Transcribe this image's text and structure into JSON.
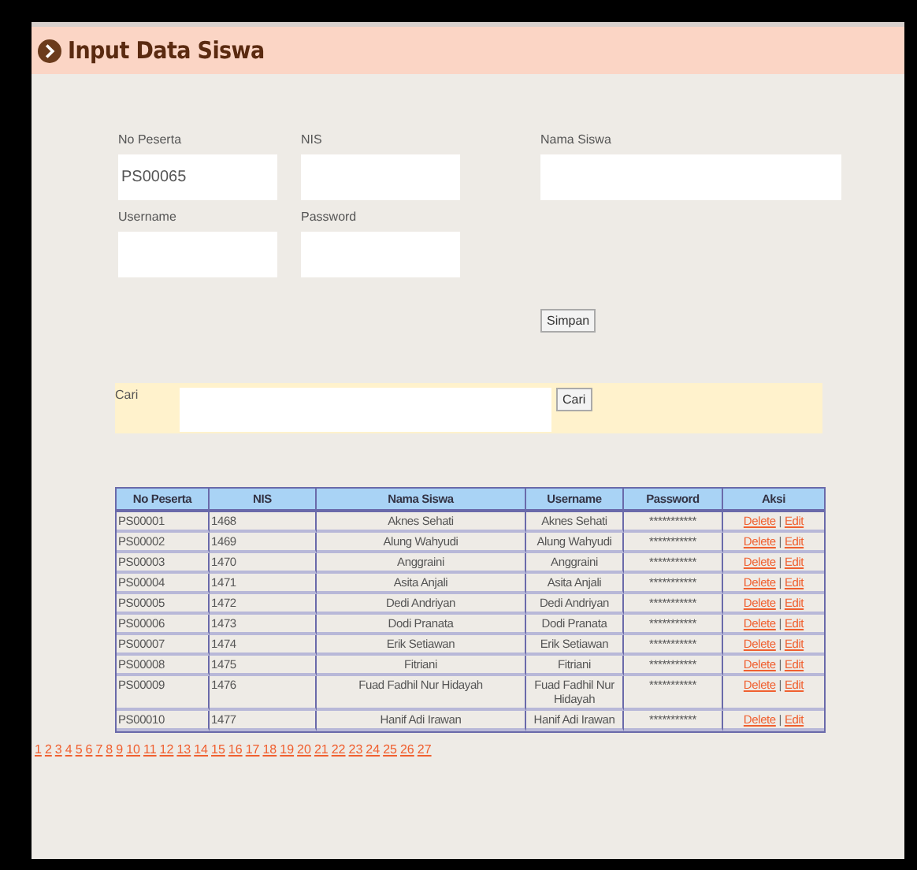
{
  "header": {
    "title": "Input Data Siswa"
  },
  "form": {
    "fields": [
      {
        "label": "No Peserta",
        "value": "PS00065",
        "kind": "short"
      },
      {
        "label": "NIS",
        "kind": "short"
      },
      {
        "label": "Nama Siswa",
        "kind": "long"
      },
      {
        "label": "Username",
        "kind": "short"
      },
      {
        "label": "Password",
        "kind": "short"
      }
    ],
    "submit": "Simpan"
  },
  "search": {
    "label": "Cari",
    "button": "Cari"
  },
  "table": {
    "columns": [
      "No Peserta",
      "NIS",
      "Nama Siswa",
      "Username",
      "Password",
      "Aksi"
    ],
    "rows": [
      {
        "cells": [
          "PS00001",
          "1468",
          "Aknes Sehati",
          "Aknes Sehati",
          "***********"
        ],
        "actions": [
          "Delete",
          "Edit"
        ]
      },
      {
        "cells": [
          "PS00002",
          "1469",
          "Alung Wahyudi",
          "Alung Wahyudi",
          "***********"
        ],
        "actions": [
          "Delete",
          "Edit"
        ]
      },
      {
        "cells": [
          "PS00003",
          "1470",
          "Anggraini",
          "Anggraini",
          "***********"
        ],
        "actions": [
          "Delete",
          "Edit"
        ]
      },
      {
        "cells": [
          "PS00004",
          "1471",
          "Asita Anjali",
          "Asita Anjali",
          "***********"
        ],
        "actions": [
          "Delete",
          "Edit"
        ]
      },
      {
        "cells": [
          "PS00005",
          "1472",
          "Dedi Andriyan",
          "Dedi Andriyan",
          "***********"
        ],
        "actions": [
          "Delete",
          "Edit"
        ]
      },
      {
        "cells": [
          "PS00006",
          "1473",
          "Dodi Pranata",
          "Dodi Pranata",
          "***********"
        ],
        "actions": [
          "Delete",
          "Edit"
        ]
      },
      {
        "cells": [
          "PS00007",
          "1474",
          "Erik Setiawan",
          "Erik Setiawan",
          "***********"
        ],
        "actions": [
          "Delete",
          "Edit"
        ]
      },
      {
        "cells": [
          "PS00008",
          "1475",
          "Fitriani",
          "Fitriani",
          "***********"
        ],
        "actions": [
          "Delete",
          "Edit"
        ]
      },
      {
        "cells": [
          "PS00009",
          "1476",
          "Fuad Fadhil Nur Hidayah",
          "Fuad Fadhil Nur Hidayah",
          "***********"
        ],
        "actions": [
          "Delete",
          "Edit"
        ]
      },
      {
        "cells": [
          "PS00010",
          "1477",
          "Hanif Adi Irawan",
          "Hanif Adi Irawan",
          "***********"
        ],
        "actions": [
          "Delete",
          "Edit"
        ]
      }
    ],
    "separator": "|"
  },
  "pagination": [
    "1",
    "2",
    "3",
    "4",
    "5",
    "6",
    "7",
    "8",
    "9",
    "10",
    "11",
    "12",
    "13",
    "14",
    "15",
    "16",
    "17",
    "18",
    "19",
    "20",
    "21",
    "22",
    "23",
    "24",
    "25",
    "26",
    "27"
  ]
}
